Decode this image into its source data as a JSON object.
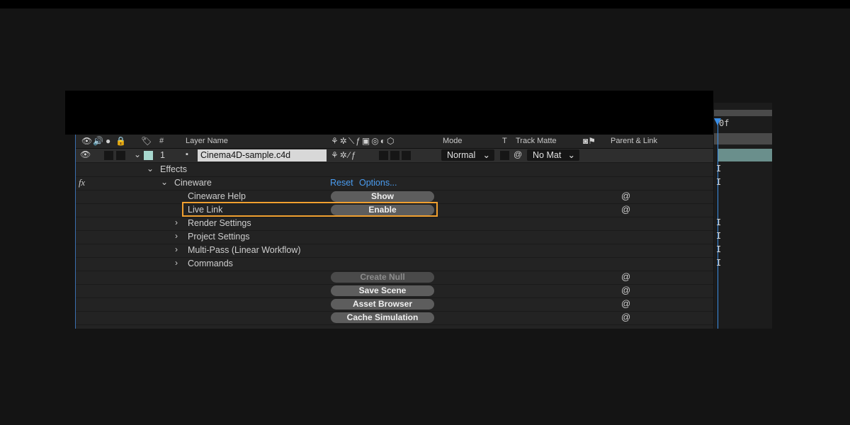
{
  "header": {
    "hash": "#",
    "layer_name": "Layer Name",
    "mode": "Mode",
    "t": "T",
    "track_matte": "Track Matte",
    "parent_link": "Parent & Link"
  },
  "layer": {
    "index": "1",
    "name": "Cinema4D-sample.c4d",
    "mode": "Normal",
    "track_matte": "No Mat",
    "label_color": "#a8d8cf"
  },
  "effects": {
    "label": "Effects",
    "fx_icon": "fx",
    "cineware": {
      "label": "Cineware",
      "reset": "Reset",
      "options": "Options..."
    },
    "properties": [
      {
        "label": "Cineware Help",
        "button": "Show"
      },
      {
        "label": "Live Link",
        "button": "Enable"
      }
    ],
    "groups": [
      "Render Settings",
      "Project Settings",
      "Multi-Pass (Linear Workflow)",
      "Commands"
    ],
    "command_buttons": [
      "Create Null",
      "Save Scene",
      "Asset Browser",
      "Cache Simulation"
    ]
  },
  "timeline": {
    "time_label": "0f"
  },
  "colors": {
    "highlight": "#f0a030",
    "link": "#4a9cf0",
    "playhead": "#3a8ee6"
  }
}
